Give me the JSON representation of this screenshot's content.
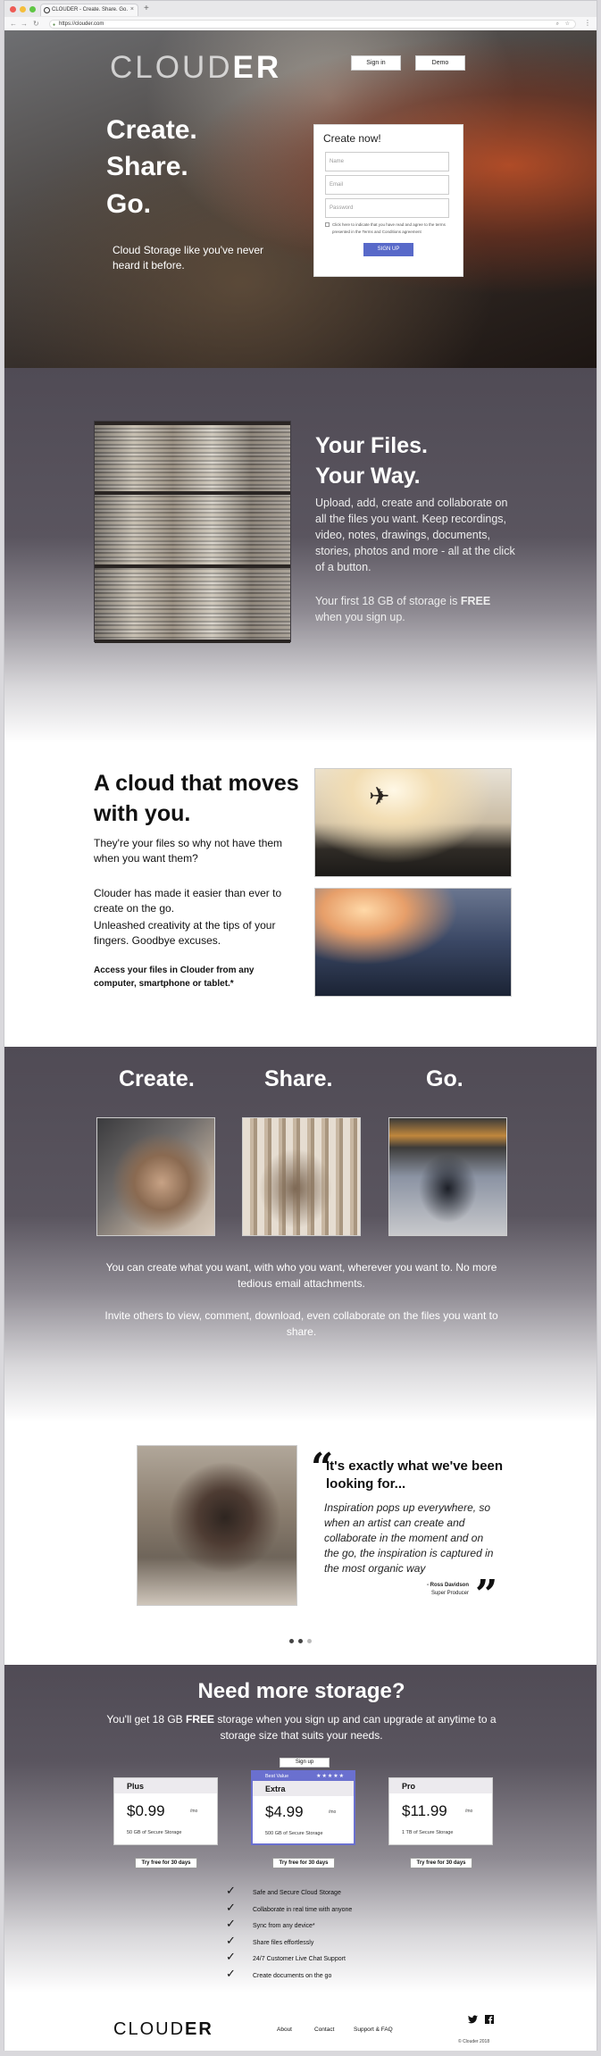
{
  "browser": {
    "tab_title": "CLOUDER - Create. Share. Go.",
    "url": "https://clouder.com",
    "new_tab": "+",
    "tab_close": "×",
    "back": "←",
    "forward": "→",
    "reload": "↻"
  },
  "hero": {
    "logo_light": "CL",
    "logo_mid": "O",
    "logo_rest": "UD",
    "logo_bold": "ER",
    "signin_label": "Sign in",
    "demo_label": "Demo",
    "tag1": "Create.",
    "tag2": "Share.",
    "tag3": "Go.",
    "subtitle": "Cloud Storage like you've never heard it before."
  },
  "signup_form": {
    "title": "Create now!",
    "name_placeholder": "Name",
    "email_placeholder": "Email",
    "password_placeholder": "Password",
    "terms": "Click here to indicate that you have read and agree to the terms presented in the Terms and Conditions agreement",
    "submit_label": "SIGN UP"
  },
  "files_section": {
    "title_line1": "Your Files.",
    "title_line2": "Your Way.",
    "body": "Upload, add, create and collaborate on all the files you want. Keep recordings, video, notes, drawings, documents, stories, photos and more - all at the click of a button.",
    "free_pre": "Your first 18 GB of storage is ",
    "free_bold": "FREE",
    "free_post": " when you sign up."
  },
  "cloud_section": {
    "title": "A cloud that moves with you.",
    "p1": "They're your files so why not have them when you want them?",
    "p2": "Clouder has made it easier than ever to create on the go.",
    "p3": "Unleashed creativity at the tips of your fingers. Goodbye excuses.",
    "bold": "Access your files in Clouder from any computer, smartphone or tablet.*"
  },
  "csg_section": {
    "create": "Create.",
    "share": "Share.",
    "go": "Go.",
    "text1": "You can create what you want, with who you want, wherever you want to. No more tedious email attachments.",
    "text2": "Invite others to view, comment, download, even collaborate on the files you want to share."
  },
  "testimonial": {
    "headline": "It's exactly what we've been looking for...",
    "quote": "Inspiration pops up everywhere, so when an artist can create and collaborate in the moment and on the go, the inspiration is captured in the most organic way",
    "name": "- Ross Davidson",
    "role": "Super Producer",
    "open_quote": "“",
    "close_quote": "”"
  },
  "pricing": {
    "title": "Need more storage?",
    "sub_pre": "You'll get 18 GB ",
    "sub_bold": "FREE",
    "sub_post": " storage when you sign up and can upgrade at anytime to a storage size that suits your needs.",
    "signup_label": "Sign up",
    "per_month": "/mo",
    "plans": [
      {
        "name": "Plus",
        "price": "$0.99",
        "desc": "50 GB of Secure Storage",
        "cta": "Try free for 30 days"
      },
      {
        "name": "Extra",
        "price": "$4.99",
        "desc": "500 GB of Secure Storage",
        "cta": "Try free for 30 days",
        "badge": "Best Value",
        "stars": "★★★★★"
      },
      {
        "name": "Pro",
        "price": "$11.99",
        "desc": "1 TB of Secure Storage",
        "cta": "Try free for 30 days"
      }
    ],
    "features": [
      "Safe and Secure Cloud Storage",
      "Collaborate in real time with anyone",
      "Sync from any device*",
      "Share files effortlessly",
      "24/7 Customer Live Chat Support",
      "Create documents on the go"
    ]
  },
  "footer": {
    "logo_light": "CL",
    "logo_mid": "O",
    "logo_rest": "UD",
    "logo_bold": "ER",
    "links": [
      "About",
      "Contact",
      "Support & FAQ"
    ],
    "copyright": "© Clouder 2018"
  },
  "colors": {
    "accent": "#5869c9",
    "section_grey": "#504b55"
  }
}
